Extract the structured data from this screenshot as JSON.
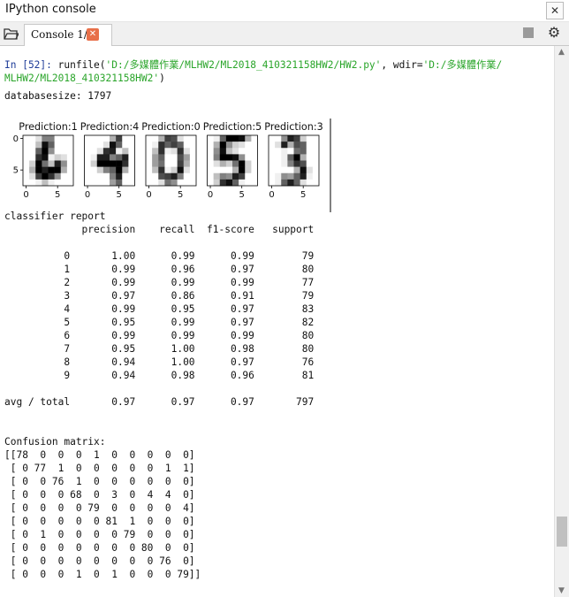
{
  "window": {
    "title": "IPython console"
  },
  "tabs": [
    {
      "label": "Console 1/A"
    }
  ],
  "console": {
    "prompt": "In [52]: ",
    "cmd_prefix": "runfile(",
    "file_path": "'D:/多媒體作業/MLHW2/ML2018_410321158HW2/HW2.py'",
    "wdir_label": ", wdir=",
    "wdir_part1": "'D:/多媒體作業/",
    "wdir_part2": "MLHW2/ML2018_410321158HW2'",
    "cmd_suffix": ")",
    "database_size": "databasesize: 1797",
    "report_text": "classifier report\n             precision    recall  f1-score   support\n\n          0       1.00      0.99      0.99        79\n          1       0.99      0.96      0.97        80\n          2       0.99      0.99      0.99        77\n          3       0.97      0.86      0.91        79\n          4       0.99      0.95      0.97        83\n          5       0.95      0.99      0.97        82\n          6       0.99      0.99      0.99        80\n          7       0.95      1.00      0.98        80\n          8       0.94      1.00      0.97        76\n          9       0.94      0.98      0.96        81\n\navg / total       0.97      0.97      0.97       797",
    "confusion_text": "Confusion matrix:\n[[78  0  0  0  1  0  0  0  0  0]\n [ 0 77  1  0  0  0  0  0  1  1]\n [ 0  0 76  1  0  0  0  0  0  0]\n [ 0  0  0 68  0  3  0  4  4  0]\n [ 0  0  0  0 79  0  0  0  0  4]\n [ 0  0  0  0  0 81  1  0  0  0]\n [ 0  1  0  0  0  0 79  0  0  0]\n [ 0  0  0  0  0  0  0 80  0  0]\n [ 0  0  0  0  0  0  0  0 76  0]\n [ 0  0  0  1  0  1  0  0  0 79]]"
  },
  "plots": {
    "titles": [
      "Prediction:1",
      "Prediction:4",
      "Prediction:0",
      "Prediction:5",
      "Prediction:3"
    ],
    "ytick_labels": [
      "0",
      "5"
    ],
    "xtick_labels": [
      "0",
      "5"
    ],
    "images": [
      [
        [
          0,
          0,
          0.12,
          0.5,
          0.5,
          0,
          0,
          0
        ],
        [
          0,
          0,
          0.25,
          0.94,
          0.62,
          0,
          0,
          0
        ],
        [
          0,
          0,
          0.62,
          1,
          0.44,
          0,
          0,
          0
        ],
        [
          0,
          0,
          0.81,
          0.94,
          0.06,
          0.19,
          0.12,
          0
        ],
        [
          0,
          0.19,
          1,
          0.56,
          0.25,
          0.88,
          0.44,
          0
        ],
        [
          0,
          0.31,
          1,
          0.88,
          1,
          1,
          0.31,
          0
        ],
        [
          0,
          0.12,
          0.75,
          1,
          0.81,
          0.44,
          0,
          0
        ],
        [
          0,
          0,
          0.06,
          0.25,
          0.06,
          0,
          0,
          0
        ]
      ],
      [
        [
          0,
          0,
          0,
          0,
          0.31,
          0.75,
          0,
          0
        ],
        [
          0,
          0,
          0,
          0.12,
          0.94,
          0.62,
          0,
          0
        ],
        [
          0,
          0,
          0.12,
          0.81,
          0.88,
          0.06,
          0.25,
          0
        ],
        [
          0,
          0.06,
          0.88,
          0.88,
          0.5,
          0.62,
          0.88,
          0
        ],
        [
          0,
          0.19,
          1,
          1,
          1,
          1,
          0.81,
          0
        ],
        [
          0,
          0,
          0.19,
          0.5,
          0.62,
          1,
          0.31,
          0
        ],
        [
          0,
          0,
          0,
          0,
          0.5,
          0.88,
          0,
          0
        ],
        [
          0,
          0,
          0,
          0,
          0.38,
          0.62,
          0,
          0
        ]
      ],
      [
        [
          0,
          0,
          0.31,
          0.75,
          0.69,
          0.12,
          0,
          0
        ],
        [
          0,
          0.06,
          0.81,
          0.62,
          0.75,
          0.62,
          0,
          0
        ],
        [
          0,
          0.25,
          0.81,
          0.06,
          0.12,
          0.81,
          0.12,
          0
        ],
        [
          0,
          0.38,
          0.62,
          0,
          0,
          0.69,
          0.38,
          0
        ],
        [
          0,
          0.38,
          0.56,
          0,
          0,
          0.75,
          0.31,
          0
        ],
        [
          0,
          0.25,
          0.81,
          0.06,
          0.19,
          0.94,
          0.12,
          0
        ],
        [
          0,
          0,
          0.69,
          0.75,
          0.88,
          0.5,
          0,
          0
        ],
        [
          0,
          0,
          0.12,
          0.56,
          0.44,
          0,
          0,
          0
        ]
      ],
      [
        [
          0,
          0.06,
          0.62,
          1,
          1,
          0.94,
          0.31,
          0
        ],
        [
          0,
          0.31,
          1,
          0.44,
          0.19,
          0.12,
          0,
          0
        ],
        [
          0,
          0.44,
          0.94,
          0.25,
          0.12,
          0,
          0,
          0
        ],
        [
          0,
          0.5,
          1,
          1,
          0.94,
          0.44,
          0,
          0
        ],
        [
          0,
          0.12,
          0.31,
          0.19,
          0.56,
          1,
          0.19,
          0
        ],
        [
          0,
          0,
          0,
          0,
          0.31,
          1,
          0.19,
          0
        ],
        [
          0,
          0.25,
          0.5,
          0.44,
          0.88,
          0.75,
          0,
          0
        ],
        [
          0,
          0.19,
          0.81,
          0.94,
          0.62,
          0.06,
          0,
          0
        ]
      ],
      [
        [
          0,
          0,
          0.44,
          0.88,
          0.75,
          0.19,
          0,
          0
        ],
        [
          0,
          0.12,
          0.88,
          0.31,
          0.69,
          0.62,
          0,
          0
        ],
        [
          0,
          0,
          0.06,
          0,
          0.56,
          0.62,
          0,
          0
        ],
        [
          0,
          0,
          0.06,
          0.62,
          1,
          0.31,
          0,
          0
        ],
        [
          0,
          0,
          0.06,
          0.5,
          0.81,
          0.69,
          0,
          0
        ],
        [
          0,
          0,
          0,
          0,
          0.31,
          0.94,
          0.12,
          0
        ],
        [
          0,
          0.06,
          0.44,
          0.38,
          0.62,
          0.88,
          0.06,
          0
        ],
        [
          0,
          0.06,
          0.62,
          0.88,
          0.62,
          0.12,
          0,
          0
        ]
      ]
    ]
  },
  "colors": {
    "prompt": "#1f3d99",
    "string": "#2aa52a",
    "tab_close": "#e8704a"
  },
  "icons": {
    "browse": "browse-icon",
    "tab_close": "close-icon",
    "stop": "stop-icon",
    "options": "gear-icon",
    "window_close": "close-icon"
  }
}
